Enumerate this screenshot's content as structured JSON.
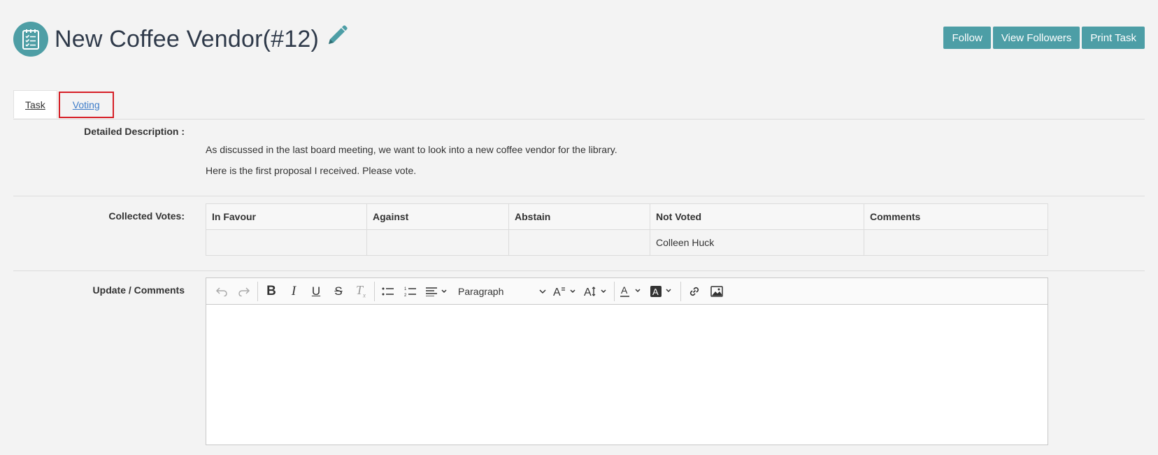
{
  "header": {
    "title": "New Coffee Vendor(#12)",
    "actions": {
      "follow": "Follow",
      "view_followers": "View Followers",
      "print_task": "Print Task"
    }
  },
  "tabs": [
    {
      "label": "Task"
    },
    {
      "label": "Voting"
    }
  ],
  "description": {
    "label": "Detailed Description :",
    "lines": [
      "As discussed in the last board meeting, we want to look into a new coffee vendor for the library.",
      "Here is the first proposal I received. Please vote."
    ]
  },
  "votes": {
    "label": "Collected Votes:",
    "columns": [
      "In Favour",
      "Against",
      "Abstain",
      "Not Voted",
      "Comments"
    ],
    "row": [
      "",
      "",
      "",
      "Colleen Huck",
      ""
    ]
  },
  "comments": {
    "label": "Update / Comments",
    "toolbar": {
      "paragraph": "Paragraph"
    }
  },
  "colors": {
    "accent": "#4d9ea6",
    "highlight": "#d61f26",
    "link": "#3d7cc9"
  }
}
